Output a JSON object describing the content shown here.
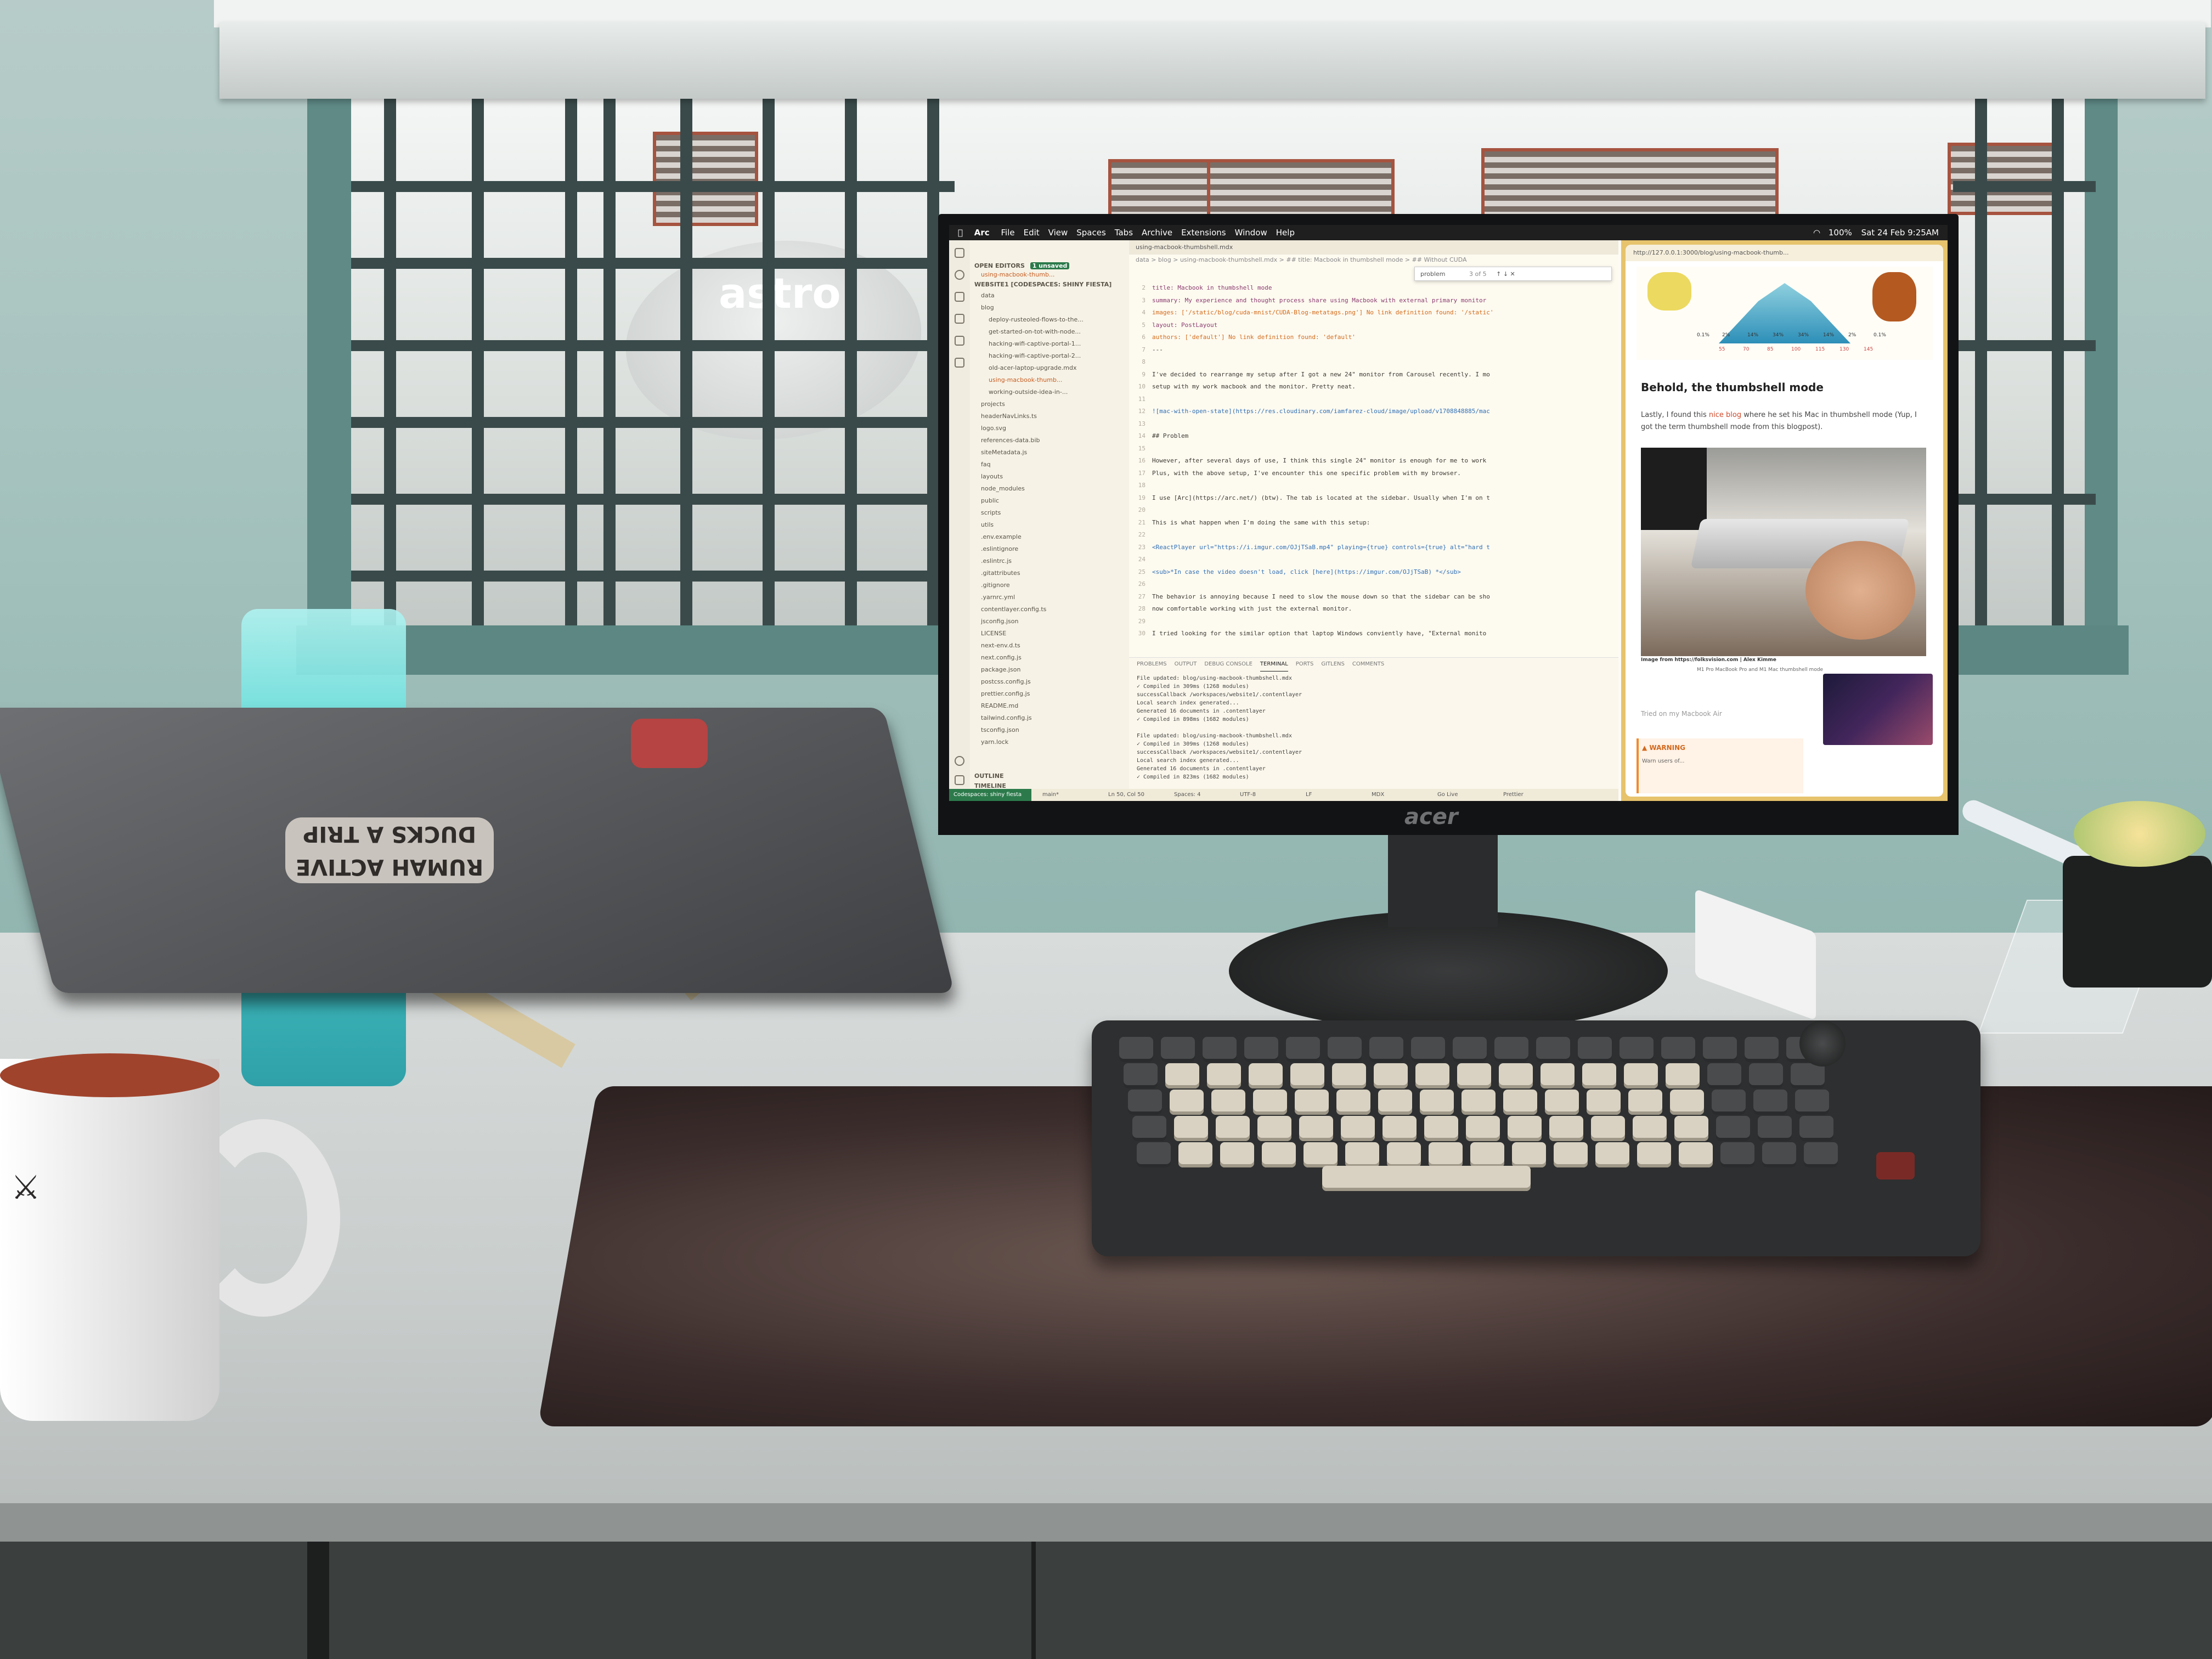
{
  "scene": {
    "satellite_dish_text": "astro",
    "monitor_brand": "acer",
    "laptop_sticker": "RUMAH ACTIVE\nDUCKS A TRIP"
  },
  "menubar": {
    "app": "Arc",
    "items": [
      "File",
      "Edit",
      "View",
      "Spaces",
      "Tabs",
      "Archive",
      "Extensions",
      "Window",
      "Help"
    ],
    "clock": "Sat 24 Feb 9:25AM",
    "battery": "100%"
  },
  "vscode": {
    "sections": {
      "open_editors": "OPEN EDITORS",
      "open_editors_badge": "1 unsaved",
      "workspace": "WEBSITE1 [CODESPACES: SHINY FIESTA]",
      "outline": "OUTLINE",
      "timeline": "TIMELINE"
    },
    "open_file": "using-macbook-thumb...",
    "explorer_items": [
      "data",
      "blog",
      "deploy-rusteoled-flows-to-the...",
      "get-started-on-tot-with-node...",
      "hacking-wifi-captive-portal-1...",
      "hacking-wifi-captive-portal-2...",
      "old-acer-laptop-upgrade.mdx",
      "using-macbook-thumb...",
      "working-outside-idea-in-...",
      "projects",
      "headerNavLinks.ts",
      "logo.svg",
      "references-data.bib",
      "siteMetadata.js",
      "faq",
      "layouts",
      "node_modules",
      "public",
      "scripts",
      "utils",
      ".env.example",
      ".eslintignore",
      ".eslintrc.js",
      ".gitattributes",
      ".gitignore",
      ".yarnrc.yml",
      "contentlayer.config.ts",
      "jsconfig.json",
      "LICENSE",
      "next-env.d.ts",
      "next.config.js",
      "package.json",
      "postcss.config.js",
      "prettier.config.js",
      "README.md",
      "tailwind.config.js",
      "tsconfig.json",
      "yarn.lock"
    ],
    "tab": "using-macbook-thumbshell.mdx",
    "breadcrumb": "data > blog > using-macbook-thumbshell.mdx > ## title: Macbook in thumbshell mode > ## Without CUDA",
    "find": "problem",
    "find_count": "3 of 5",
    "code_lines": [
      {
        "n": "2",
        "text": "title: Macbook in thumbshell mode"
      },
      {
        "n": "3",
        "text": "summary: My experience and thought process share using Macbook with external primary monitor"
      },
      {
        "n": "4",
        "text": "images: ['/static/blog/cuda-mnist/CUDA-Blog-metatags.png']   No link definition found: '/static'"
      },
      {
        "n": "5",
        "text": "layout: PostLayout"
      },
      {
        "n": "6",
        "text": "authors: ['default']   No link definition found: 'default'"
      },
      {
        "n": "7",
        "text": "---"
      },
      {
        "n": "8",
        "text": ""
      },
      {
        "n": "9",
        "text": "I've decided to rearrange my setup after I got a new 24\" monitor from Carousel recently. I mo"
      },
      {
        "n": "10",
        "text": "setup with my work macbook and the monitor. Pretty neat."
      },
      {
        "n": "11",
        "text": ""
      },
      {
        "n": "12",
        "text": "![mac-with-open-state](https://res.cloudinary.com/iamfarez-cloud/image/upload/v1708848885/mac"
      },
      {
        "n": "13",
        "text": ""
      },
      {
        "n": "14",
        "text": "## Problem"
      },
      {
        "n": "15",
        "text": ""
      },
      {
        "n": "16",
        "text": "However, after several days of use, I think this single 24\" monitor is enough for me to work"
      },
      {
        "n": "17",
        "text": "Plus, with the above setup, I've encounter this one specific problem with my browser."
      },
      {
        "n": "18",
        "text": ""
      },
      {
        "n": "19",
        "text": "I use [Arc](https://arc.net/) (btw). The tab is located at the sidebar. Usually when I'm on t"
      },
      {
        "n": "20",
        "text": ""
      },
      {
        "n": "21",
        "text": "This is what happen when I'm doing the same with this setup:"
      },
      {
        "n": "22",
        "text": ""
      },
      {
        "n": "23",
        "text": "<ReactPlayer url=\"https://i.imgur.com/OJjTSaB.mp4\" playing={true} controls={true} alt=\"hard t"
      },
      {
        "n": "24",
        "text": ""
      },
      {
        "n": "25",
        "text": "<sub>*In case the video doesn't load, click [here](https://imgur.com/OJjTSaB) *</sub>"
      },
      {
        "n": "26",
        "text": ""
      },
      {
        "n": "27",
        "text": "The behavior is annoying because I need to slow the mouse down so that the sidebar can be sho"
      },
      {
        "n": "28",
        "text": "now comfortable working with just the external monitor."
      },
      {
        "n": "29",
        "text": ""
      },
      {
        "n": "30",
        "text": "I tried looking for the similar option that laptop Windows conviently have, \"External monito"
      }
    ],
    "panel_tabs": [
      "PROBLEMS",
      "OUTPUT",
      "DEBUG CONSOLE",
      "TERMINAL",
      "PORTS",
      "GITLENS",
      "COMMENTS"
    ],
    "terminal_lines": [
      "File updated: blog/using-macbook-thumbshell.mdx",
      "✓ Compiled in 309ms (1268 modules)",
      "successCallback /workspaces/website1/.contentlayer",
      "Local search index generated...",
      "Generated 16 documents in .contentlayer",
      "✓ Compiled in 898ms (1682 modules)",
      "",
      "File updated: blog/using-macbook-thumbshell.mdx",
      "✓ Compiled in 309ms (1268 modules)",
      "successCallback /workspaces/website1/.contentlayer",
      "Local search index generated...",
      "Generated 16 documents in .contentlayer",
      "✓ Compiled in 823ms (1682 modules)"
    ],
    "status_remote": "Codespaces: shiny fiesta",
    "status_items": [
      "main*",
      "Ln 50, Col 50",
      "Spaces: 4",
      "UTF-8",
      "LF",
      "MDX",
      "Go Live",
      "Prettier"
    ]
  },
  "browser": {
    "url": "http://127.0.0.1:3000/blog/using-macbook-thumb...",
    "chart_axis": [
      "55",
      "70",
      "85",
      "100",
      "115",
      "130",
      "145"
    ],
    "chart_pct": [
      "0.1%",
      "2%",
      "14%",
      "34%",
      "34%",
      "14%",
      "2%",
      "0.1%"
    ],
    "heading": "Behold, the thumbshell mode",
    "paragraph_pre": "Lastly, I found this ",
    "paragraph_link": "nice blog",
    "paragraph_post": " where he set his Mac in thumbshell mode (Yup, I got the term thumbshell mode from this blogpost).",
    "photo_caption": "Image from https://folksvision.com | Alex Kimme",
    "photo_caption2": "M1 Pro MacBook Pro and M1 Mac thumbshell mode",
    "tried": "Tried on my Macbook Air",
    "warning_title": "WARNING",
    "warning_body": "Warn users of..."
  }
}
